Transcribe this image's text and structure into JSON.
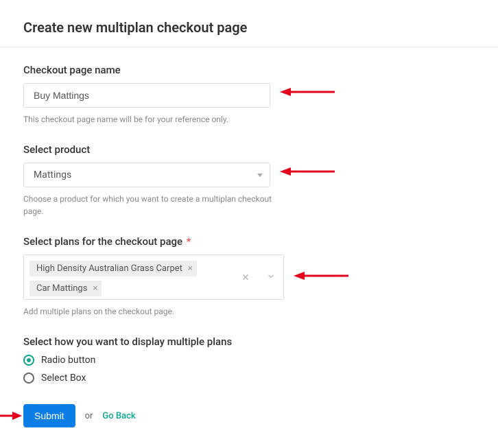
{
  "title": "Create new multiplan checkout page",
  "fields": {
    "name": {
      "label": "Checkout page name",
      "value": "Buy Mattings",
      "help": "This checkout page name will be for your reference only."
    },
    "product": {
      "label": "Select product",
      "value": "Mattings",
      "help": "Choose a product for which you want to create a multiplan checkout page."
    },
    "plans": {
      "label": "Select plans for the checkout page",
      "tags": [
        "High Density Australian Grass Carpet",
        "Car Mattings"
      ],
      "help": "Add multiple plans on the checkout page."
    },
    "display": {
      "label": "Select how you want to display multiple plans",
      "options": [
        "Radio button",
        "Select Box"
      ],
      "selected": "Radio button"
    }
  },
  "actions": {
    "submit": "Submit",
    "or": "or",
    "back": "Go Back"
  }
}
